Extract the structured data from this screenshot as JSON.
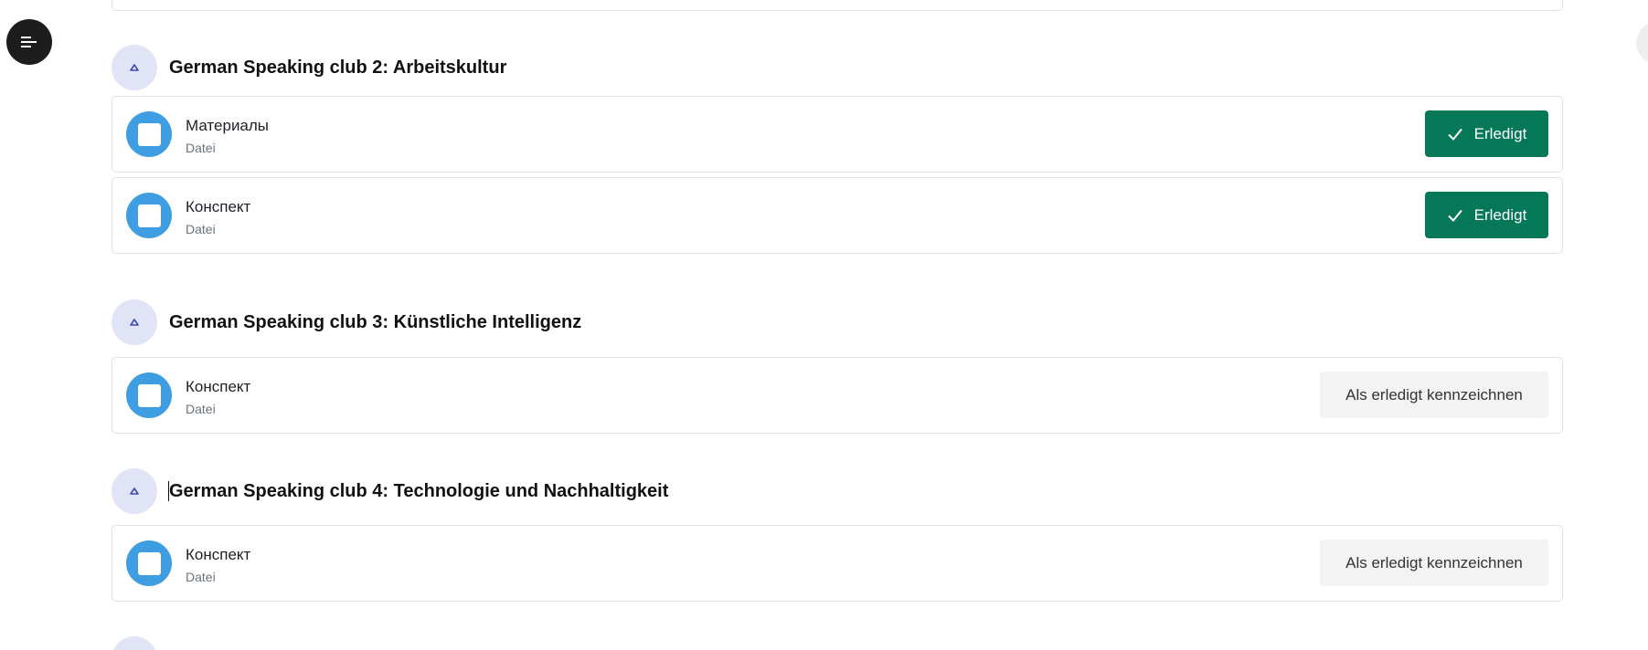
{
  "sections": [
    {
      "title": "German Speaking club 2: Arbeitskultur",
      "activities": [
        {
          "name": "Материалы",
          "type": "Datei",
          "status": "Erledigt"
        },
        {
          "name": "Конспект",
          "type": "Datei",
          "status": "Erledigt"
        }
      ]
    },
    {
      "title": "German Speaking club 3: Künstliche Intelligenz",
      "activities": [
        {
          "name": "Конспект",
          "type": "Datei",
          "status": "Als erledigt kennzeichnen"
        }
      ]
    },
    {
      "title": "German Speaking club 4: Technologie und Nachhaltigkeit",
      "activities": [
        {
          "name": "Конспект",
          "type": "Datei",
          "status": "Als erledigt kennzeichnen"
        }
      ]
    }
  ],
  "icons": {
    "drawer": "menu-icon",
    "collapse": "chevron-up-icon",
    "activity": "file-icon",
    "done": "check-icon"
  },
  "colors": {
    "done_button": "#047857",
    "activity_icon": "#3f9de2",
    "collapse_bg": "#e1e3f6",
    "mark_button": "#f3f3f3"
  }
}
